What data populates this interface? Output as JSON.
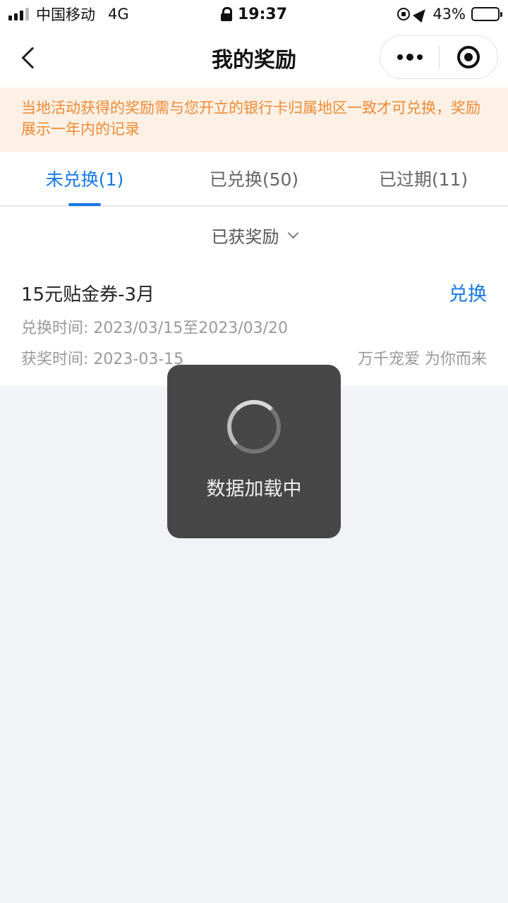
{
  "status_bar": {
    "carrier": "中国移动",
    "network": "4G",
    "time": "19:37",
    "battery": "43%",
    "battery_level": 0.43
  },
  "nav": {
    "title": "我的奖励"
  },
  "notice": {
    "text": "当地活动获得的奖励需与您开立的银行卡归属地区一致才可兑换，奖励展示一年内的记录"
  },
  "tabs": [
    {
      "label": "未兑换(1)",
      "active": true
    },
    {
      "label": "已兑换(50)",
      "active": false
    },
    {
      "label": "已过期(11)",
      "active": false
    }
  ],
  "filter": {
    "label": "已获奖励"
  },
  "rewards": [
    {
      "title": "15元贴金券-3月",
      "action": "兑换",
      "redeem_period": "兑换时间: 2023/03/15至2023/03/20",
      "award_time": "获奖时间: 2023-03-15",
      "slogan": "万千宠爱 为你而来"
    }
  ],
  "toast": {
    "text": "数据加载中"
  },
  "colors": {
    "accent": "#1677e6",
    "notice_text": "#f08a33",
    "notice_bg": "#fdf1e6",
    "page_bg": "#f2f3f7"
  }
}
